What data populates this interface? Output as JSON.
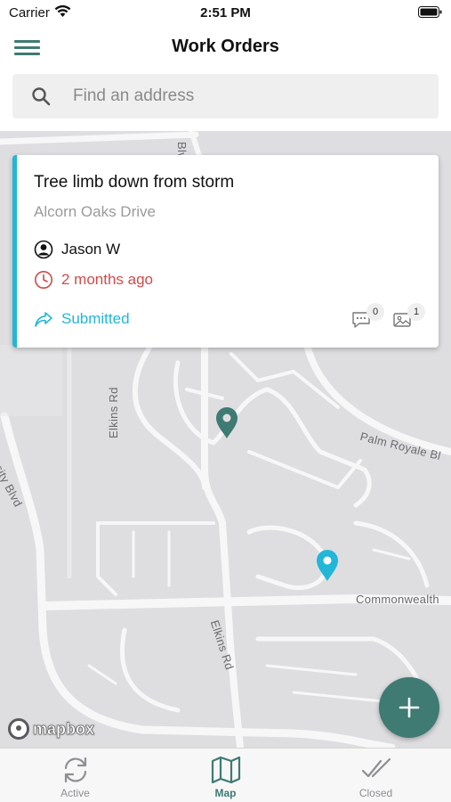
{
  "status_bar": {
    "carrier": "Carrier",
    "time": "2:51 PM"
  },
  "header": {
    "title": "Work Orders"
  },
  "search": {
    "placeholder": "Find an address",
    "value": ""
  },
  "work_order": {
    "title": "Tree limb down from storm",
    "address": "Alcorn Oaks Drive",
    "assignee": "Jason W",
    "time_ago": "2 months ago",
    "status": "Submitted",
    "comment_count": "0",
    "photo_count": "1"
  },
  "map": {
    "streets": {
      "blvd_top": "Blvd",
      "elkins_rd_north": "Elkins Rd",
      "palm_royale": "Palm Royale Bl",
      "university_blvd": "rsity Blvd",
      "commonwealth": "Commonwealth",
      "elkins_rd_south": "Elkins Rd"
    },
    "attribution": "mapbox"
  },
  "tabs": [
    {
      "label": "Active",
      "icon": "refresh-icon"
    },
    {
      "label": "Map",
      "icon": "map-icon"
    },
    {
      "label": "Closed",
      "icon": "double-check-icon"
    }
  ],
  "colors": {
    "brand": "#3f7a73",
    "accent": "#22b6d8",
    "overdue": "#d24a4a",
    "map_background": "#dedee1",
    "map_roads": "#f7f7f8"
  }
}
